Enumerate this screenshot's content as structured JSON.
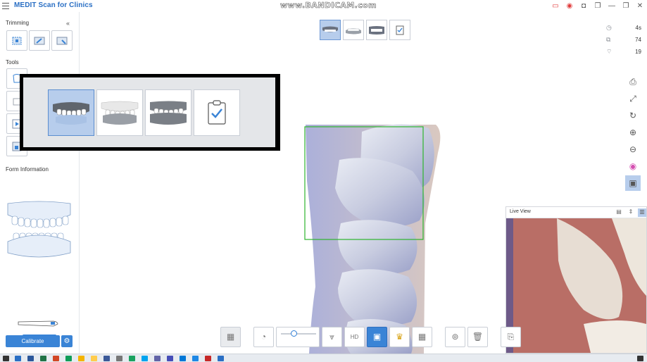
{
  "app": {
    "title": "MEDIT Scan for Clinics"
  },
  "watermark": "www.BANDICAM.com",
  "left_panel": {
    "trimming_label": "Trimming",
    "tools_label": "Tools",
    "form_label": "Form Information",
    "calibrate_label": "Calibrate"
  },
  "stats": {
    "time": "4s",
    "count_a": "74",
    "count_b": "19"
  },
  "live_view": {
    "title": "Live View"
  },
  "stage_tabs": [
    "maxilla",
    "mandible",
    "occlusion",
    "review"
  ],
  "active_stage": "maxilla",
  "colors": {
    "accent": "#3a84d6",
    "active_tab_bg": "#b7cdec",
    "brand_text": "#2a6fc4",
    "trim_box": "#2db52d"
  }
}
